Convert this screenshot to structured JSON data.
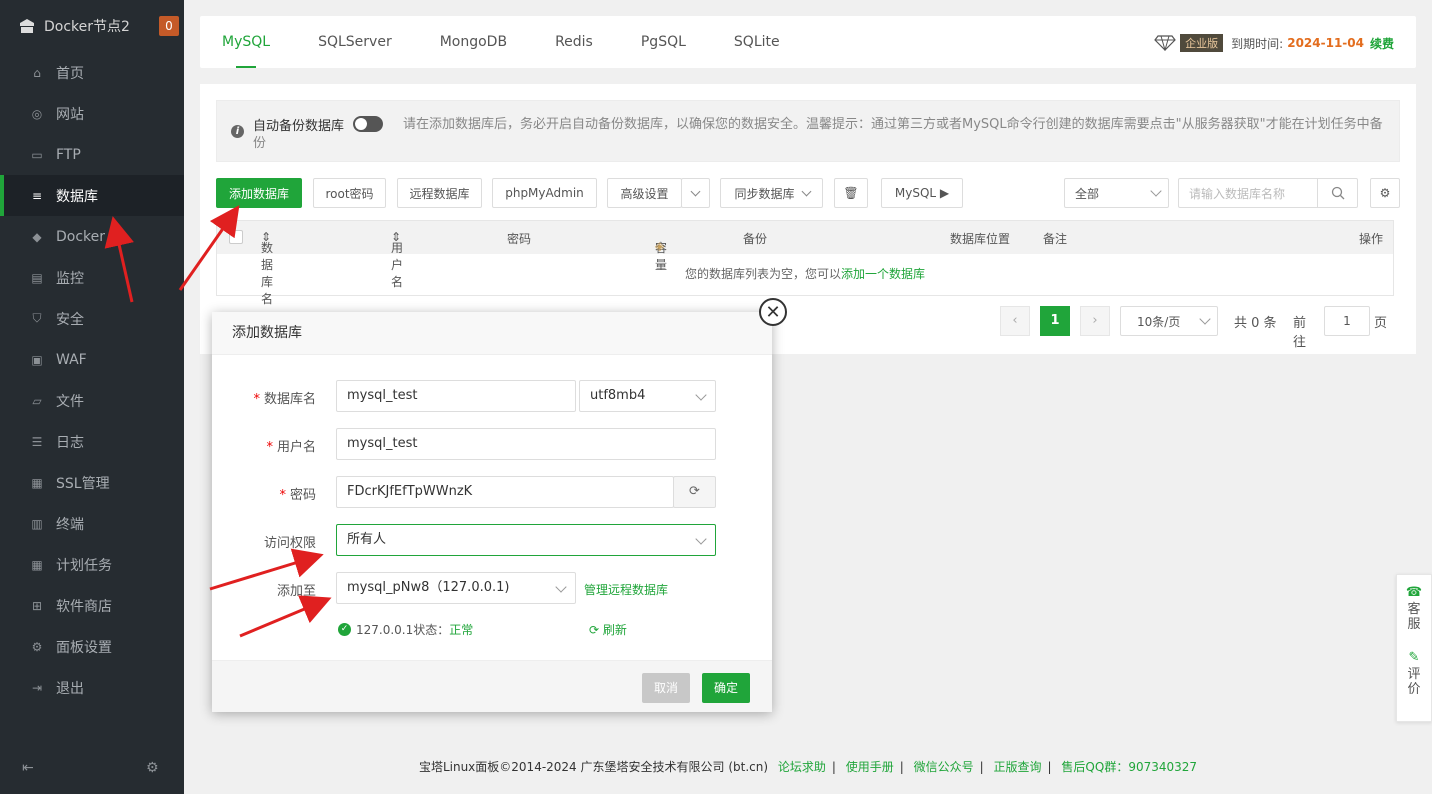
{
  "sidebar": {
    "node_title": "Docker节点2",
    "badge": "0",
    "items": [
      {
        "label": "首页",
        "icon": "home-icon"
      },
      {
        "label": "网站",
        "icon": "globe-icon"
      },
      {
        "label": "FTP",
        "icon": "ftp-icon"
      },
      {
        "label": "数据库",
        "icon": "database-icon"
      },
      {
        "label": "Docker",
        "icon": "docker-icon"
      },
      {
        "label": "监控",
        "icon": "monitor-icon"
      },
      {
        "label": "安全",
        "icon": "shield-icon"
      },
      {
        "label": "WAF",
        "icon": "waf-icon"
      },
      {
        "label": "文件",
        "icon": "folder-icon"
      },
      {
        "label": "日志",
        "icon": "log-icon"
      },
      {
        "label": "SSL管理",
        "icon": "ssl-icon"
      },
      {
        "label": "终端",
        "icon": "terminal-icon"
      },
      {
        "label": "计划任务",
        "icon": "calendar-icon"
      },
      {
        "label": "软件商店",
        "icon": "apps-icon"
      },
      {
        "label": "面板设置",
        "icon": "settings-icon"
      },
      {
        "label": "退出",
        "icon": "logout-icon"
      }
    ]
  },
  "tabs": [
    "MySQL",
    "SQLServer",
    "MongoDB",
    "Redis",
    "PgSQL",
    "SQLite"
  ],
  "edition": {
    "tag": "企业版",
    "expire_label": "到期时间:",
    "expire_date": "2024-11-04",
    "renew": "续费"
  },
  "notice": {
    "auto_backup_label": "自动备份数据库",
    "text": "请在添加数据库后，务必开启自动备份数据库，以确保您的数据安全。温馨提示：通过第三方或者MySQL命令行创建的数据库需要点击\"从服务器获取\"才能在计划任务中备份"
  },
  "toolbar": {
    "add_db": "添加数据库",
    "root_pwd": "root密码",
    "remote_db": "远程数据库",
    "phpmyadmin": "phpMyAdmin",
    "advanced": "高级设置",
    "sync": "同步数据库",
    "mysql_btn": "MySQL ▶",
    "filter_all": "全部",
    "search_placeholder": "请输入数据库名称"
  },
  "table": {
    "headers": {
      "name": "数据库名",
      "user": "用户名",
      "pwd": "密码",
      "capacity": "容量",
      "backup": "备份",
      "location": "数据库位置",
      "note": "备注",
      "ops": "操作"
    },
    "empty_text": "您的数据库列表为空，您可以",
    "empty_link": "添加一个数据库"
  },
  "pager": {
    "current": "1",
    "per_page": "10条/页",
    "total": "共 0 条",
    "goto_label": "前往",
    "goto_value": "1",
    "page_suffix": "页"
  },
  "modal": {
    "title": "添加数据库",
    "db_name_label": "数据库名",
    "db_name_value": "mysql_test",
    "charset": "utf8mb4",
    "user_label": "用户名",
    "user_value": "mysql_test",
    "pwd_label": "密码",
    "pwd_value": "FDcrKJfEfTpWWnzK",
    "access_label": "访问权限",
    "access_value": "所有人",
    "add_to_label": "添加至",
    "add_to_value": "mysql_pNw8（127.0.0.1)",
    "manage_remote": "管理远程数据库",
    "status_text": "127.0.0.1状态：",
    "status_value": "正常",
    "refresh": "刷新",
    "cancel": "取消",
    "confirm": "确定"
  },
  "side_help": {
    "service": "客服",
    "review": "评价"
  },
  "footer": {
    "copyright": "宝塔Linux面板©2014-2024 广东堡塔安全技术有限公司 (bt.cn)",
    "links": [
      "论坛求助",
      "使用手册",
      "微信公众号",
      "正版查询",
      "售后QQ群：907340327"
    ]
  },
  "colors": {
    "accent": "#20a53a",
    "sidebar": "#262c31",
    "warn": "#e36d1e"
  }
}
